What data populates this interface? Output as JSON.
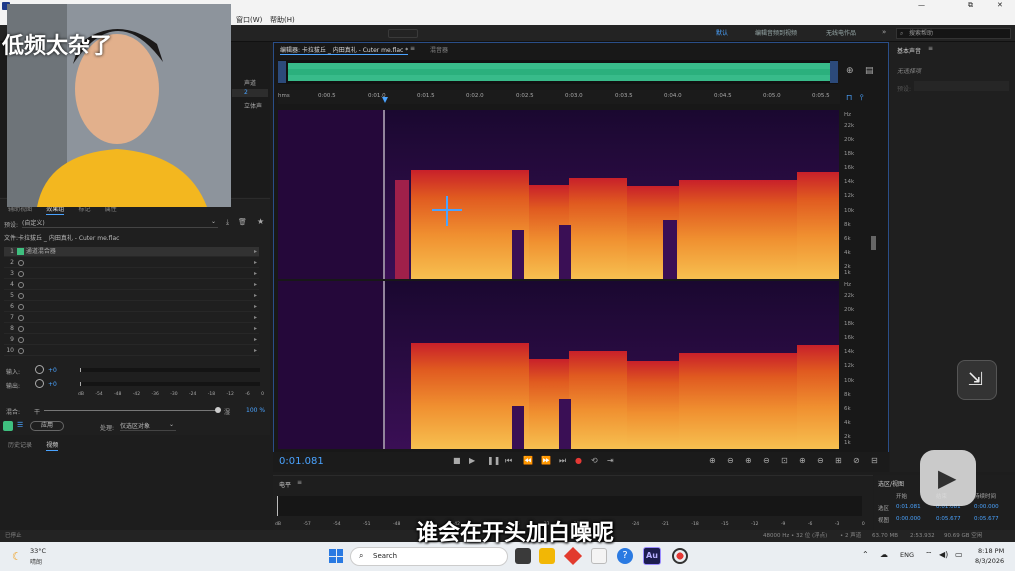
{
  "titlebar": {
    "controls": [
      "—",
      "⧉",
      "✕"
    ]
  },
  "menubar": {
    "items": [
      "窗口(W)",
      "帮助(H)"
    ]
  },
  "toolbar": {
    "workspaces": [
      "默认",
      "编辑音频到视频",
      "无线电作品"
    ],
    "active": "默认",
    "search_placeholder": "搜索帮助"
  },
  "overlay": {
    "top_text": "低频太杂了",
    "subtitle": "谁会在开头加白噪呢"
  },
  "leftpanel": {
    "channel_labels": [
      "声道",
      "2",
      "立体声"
    ],
    "tabs": [
      "辅助视图",
      "效果组",
      "标记",
      "属性"
    ],
    "active_tab": "效果组",
    "preset_label": "预设:",
    "preset_value": "(自定义)",
    "file_label": "文件:卡拉拔丘 _ 内田真礼 - Cuter me.flac",
    "effects": [
      "1",
      "2",
      "3",
      "4",
      "5",
      "6",
      "7",
      "8",
      "9",
      "10"
    ],
    "first_effect": "通道混合器",
    "input_label": "输入:",
    "output_label": "输出:",
    "gain_value": "+0",
    "meter_ticks": [
      "dB",
      "-54",
      "-48",
      "-42",
      "-36",
      "-30",
      "-24",
      "-18",
      "-12",
      "-6",
      "0"
    ],
    "mix_label": "混合:",
    "dry_label": "干",
    "wet_label": "湿",
    "mix_percent": "100 %",
    "apply_label": "应用",
    "process_label": "处理:",
    "process_value": "仅选区对象",
    "bottom_tabs": [
      "历史记录",
      "视频"
    ]
  },
  "editor": {
    "tab_title": "编辑器: 卡拉拔丘 _ 内田真礼 - Cuter me.flac *",
    "mixer_tab": "混音器",
    "ruler": [
      "hms",
      "0:00.5",
      "0:01.0",
      "0:01.5",
      "0:02.0",
      "0:02.5",
      "0:03.0",
      "0:03.5",
      "0:04.0",
      "0:04.5",
      "0:05.0",
      "0:05.5"
    ],
    "hz_upper": [
      "Hz",
      "22k",
      "20k",
      "18k",
      "16k",
      "14k",
      "12k",
      "10k",
      "8k",
      "6k",
      "4k",
      "2k",
      "1k"
    ],
    "hz_lower": [
      "Hz",
      "22k",
      "20k",
      "18k",
      "16k",
      "14k",
      "12k",
      "10k",
      "8k",
      "6k",
      "4k",
      "2k",
      "1k"
    ],
    "time_display": "0:01.081"
  },
  "levels": {
    "title": "电平",
    "ticks": [
      "dB",
      "-57",
      "-54",
      "-51",
      "-48",
      "-45",
      "-42",
      "-39",
      "-36",
      "-33",
      "-30",
      "-27",
      "-24",
      "-21",
      "-18",
      "-15",
      "-12",
      "-9",
      "-6",
      "-3",
      "0"
    ]
  },
  "rightpanel": {
    "title": "基本声音",
    "subtitle": "无选择项",
    "preset_label": "预设:"
  },
  "selview": {
    "title": "选区/视图",
    "headers": [
      "开始",
      "结束",
      "持续时间"
    ],
    "rows": [
      {
        "label": "选区",
        "start": "0:01.081",
        "end": "0:01.081",
        "dur": "0:00.000"
      },
      {
        "label": "视图",
        "start": "0:00.000",
        "end": "0:05.677",
        "dur": "0:05.677"
      }
    ]
  },
  "statusbar": {
    "left": "已停止",
    "info": [
      "48000 Hz • 32 位 (浮点)",
      "• 2 声道",
      "63.70 MB",
      "2:53.932",
      "90.69 GB 空闲"
    ]
  },
  "taskbar": {
    "weather_temp": "33°C",
    "weather_desc": "晴朗",
    "search": "Search",
    "lang": "ENG",
    "time": "8:18 PM",
    "date": "8/3/2026"
  },
  "colors": {
    "accent": "#4aa3ff",
    "wave": "#3fd9a0"
  }
}
